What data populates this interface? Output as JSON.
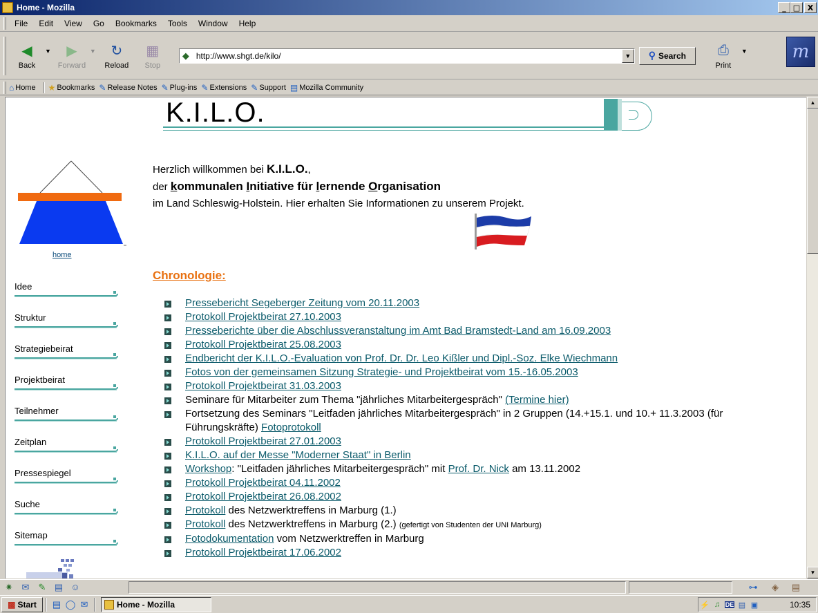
{
  "window": {
    "title": "Home - Mozilla",
    "min": "_",
    "max": "□",
    "close": "X"
  },
  "menu": [
    "File",
    "Edit",
    "View",
    "Go",
    "Bookmarks",
    "Tools",
    "Window",
    "Help"
  ],
  "toolbar": {
    "back": "Back",
    "forward": "Forward",
    "reload": "Reload",
    "stop": "Stop",
    "url": "http://www.shgt.de/kilo/",
    "search": "Search",
    "print": "Print"
  },
  "personal": [
    "Home",
    "Bookmarks",
    "Release Notes",
    "Plug-ins",
    "Extensions",
    "Support",
    "Mozilla Community"
  ],
  "page": {
    "title": "K.I.L.O.",
    "home": "home",
    "nav": [
      "Idee",
      "Struktur",
      "Strategiebeirat",
      "Projektbeirat",
      "Teilnehmer",
      "Zeitplan",
      "Pressespiegel",
      "Suche",
      "Sitemap"
    ],
    "welcome": {
      "l1a": "Herzlich willkommen bei ",
      "l1b": "K.I.L.O.",
      "l1c": ",",
      "l2a": "der ",
      "l2_k": "k",
      "l2_k_rest": "ommunalen ",
      "l2_i": "I",
      "l2_i_rest": "nitiative für ",
      "l2_l": "l",
      "l2_l_rest": "ernende ",
      "l2_o": "O",
      "l2_o_rest": "rganisation",
      "l3": "im Land Schleswig-Holstein. Hier erhalten Sie Informationen zu unserem Projekt."
    },
    "chrono_title": "Chronologie: ",
    "chrono": {
      "i0": "Pressebericht Segeberger Zeitung vom 20.11.2003",
      "i1": "Protokoll Projektbeirat 27.10.2003",
      "i2": "Presseberichte über die Abschlussveranstaltung im Amt Bad Bramstedt-Land am 16.09.2003",
      "i3": "Protokoll Projektbeirat 25.08.2003",
      "i4": "Endbericht der K.I.L.O.-Evaluation von Prof. Dr. Dr. Leo Kißler und Dipl.-Soz. Elke Wiechmann",
      "i5": "Fotos von der gemeinsamen Sitzung Strategie- und Projektbeirat vom 15.-16.05.2003",
      "i6": "Protokoll Projektbeirat 31.03.2003",
      "i7_text": "Seminare für Mitarbeiter zum Thema \"jährliches Mitarbeitergespräch\"  ",
      "i7_link": "(Termine hier)",
      "i8_text": "Fortsetzung des Seminars \"Leitfaden jährliches Mitarbeitergespräch\" in 2 Gruppen (14.+15.1. und 10.+ 11.3.2003 (für Führungskräfte) ",
      "i8_link": "Fotoprotokoll",
      "i9": "Protokoll Projektbeirat 27.01.2003",
      "i10": "K.I.L.O. auf der Messe \"Moderner Staat\" in Berlin",
      "i11_link": "Workshop",
      "i11_text": ": \"Leitfaden jährliches Mitarbeitergespräch\" mit ",
      "i11_link2": "Prof. Dr. Nick",
      "i11_text2": " am 13.11.2002",
      "i12": "Protokoll Projektbeirat 04.11.2002",
      "i13": "Protokoll Projektbeirat 26.08.2002",
      "i14_link": "Protokoll",
      "i14_text": " des Netzwerktreffens in Marburg (1.)",
      "i15_link": "Protokoll",
      "i15_text": " des Netzwerktreffens in Marburg (2.) ",
      "i15_small": "(gefertigt von Studenten der UNI Marburg)",
      "i16_link": "Fotodokumentation",
      "i16_text": " vom Netzwerktreffen in Marburg",
      "i17": "Protokoll Projektbeirat 17.06.2002"
    }
  },
  "taskbar": {
    "start": "Start",
    "task": "Home - Mozilla",
    "lang": "DE",
    "clock": "10:35"
  },
  "colors": {
    "teal": "#4aa6a0",
    "orange": "#e87010",
    "link": "#0a5a6a",
    "titlebar": "#0a246a"
  }
}
